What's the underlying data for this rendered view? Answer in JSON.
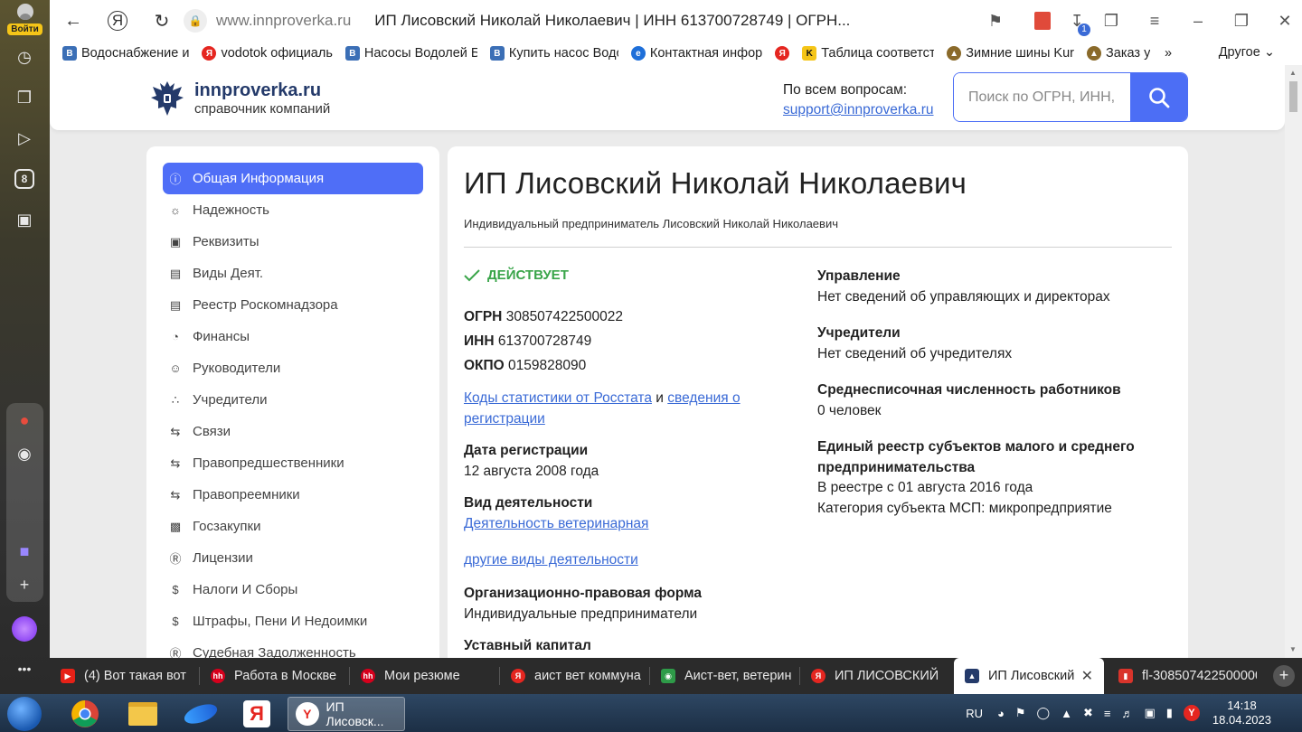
{
  "rail": {
    "login_label": "Войти",
    "tab_badge": "8"
  },
  "browser": {
    "host": "www.innproverka.ru",
    "page_title": "ИП Лисовский Николай Николаевич | ИНН 613700728749 | ОГРН...",
    "downloads_badge": "1"
  },
  "bookmarks": {
    "items": [
      {
        "label": "Водоснабжение и",
        "icon": "vk-icon",
        "color": "#3b6fb6"
      },
      {
        "label": "vodotok официаль",
        "icon": "yandex-icon",
        "color": "#e52620"
      },
      {
        "label": "Насосы Водолей Б",
        "icon": "vk-icon",
        "color": "#3b6fb6"
      },
      {
        "label": "Купить насос Водо",
        "icon": "vk-icon",
        "color": "#3b6fb6"
      },
      {
        "label": "Контактная инфор",
        "icon": "edge-icon",
        "color": "#1e6fd9"
      },
      {
        "label": "",
        "icon": "yandex-icon",
        "color": "#e52620"
      },
      {
        "label": "Таблица соответст",
        "icon": "k-icon",
        "color": "#111111"
      },
      {
        "label": "Зимние шины Kur",
        "icon": "bird-icon",
        "color": "#8a6a2a"
      },
      {
        "label": "Заказ у",
        "icon": "bird-icon",
        "color": "#8a6a2a"
      }
    ],
    "other_label": "Другое"
  },
  "site": {
    "logo_name": "innproverka.ru",
    "logo_sub": "справочник компаний",
    "contact_label": "По всем вопросам:",
    "contact_email": "support@innproverka.ru",
    "search_placeholder": "Поиск по ОГРН, ИНН, н"
  },
  "sidebar": {
    "items": [
      {
        "label": "Общая Информация",
        "icon": "info-icon",
        "active": true
      },
      {
        "label": "Надежность",
        "icon": "bulb-icon"
      },
      {
        "label": "Реквизиты",
        "icon": "qr-icon"
      },
      {
        "label": "Виды Деят.",
        "icon": "briefcase-icon"
      },
      {
        "label": "Реестр Роскомнадзора",
        "icon": "briefcase-icon"
      },
      {
        "label": "Финансы",
        "icon": "pie-icon"
      },
      {
        "label": "Руководители",
        "icon": "person-icon"
      },
      {
        "label": "Учредители",
        "icon": "group-icon"
      },
      {
        "label": "Связи",
        "icon": "swap-icon"
      },
      {
        "label": "Правопредшественники",
        "icon": "swap-icon"
      },
      {
        "label": "Правопреемники",
        "icon": "swap-icon"
      },
      {
        "label": "Госзакупки",
        "icon": "money-icon"
      },
      {
        "label": "Лицензии",
        "icon": "tm-icon"
      },
      {
        "label": "Налоги И Сборы",
        "icon": "dollar-icon"
      },
      {
        "label": "Штрафы, Пени И Недоимки",
        "icon": "dollar-icon"
      },
      {
        "label": "Судебная Задолженность",
        "icon": "tm-icon"
      }
    ]
  },
  "company": {
    "title": "ИП Лисовский Николай Николаевич",
    "full_name": "Индивидуальный предприниматель Лисовский Николай Николаевич",
    "status": "ДЕЙСТВУЕТ",
    "ogrn_label": "ОГРН",
    "ogrn": "308507422500022",
    "inn_label": "ИНН",
    "inn": "613700728749",
    "okpo_label": "ОКПО",
    "okpo": "0159828090",
    "codes_link": "Коды статистики от Росстата",
    "and": "и",
    "reg_link_1": "сведения о",
    "reg_link_2": "регистрации",
    "reg_date_label": "Дата регистрации",
    "reg_date": "12 августа 2008 года",
    "activity_label": "Вид деятельности",
    "activity": "Деятельность ветеринарная",
    "other_activity": "другие виды деятельности",
    "opf_label": "Организационно-правовая форма",
    "opf": "Индивидуальные предприниматели",
    "capital_label": "Уставный капитал",
    "mgmt_label": "Управление",
    "mgmt": "Нет сведений об управляющих и директорах",
    "founders_label": "Учредители",
    "founders": "Нет сведений об учредителях",
    "staff_label": "Среднесписочная численность работников",
    "staff": "0 человек",
    "msp_label_1": "Единый реестр субъектов малого и среднего",
    "msp_label_2": "предпринимательства",
    "msp_since": "В реестре с 01 августа 2016 года",
    "msp_category": "Категория субъекта МСП: микропредприятие"
  },
  "tabs": [
    {
      "label": "(4) Вот такая вот",
      "icon": "youtube-icon",
      "color": "#e62117"
    },
    {
      "label": "Работа в Москве",
      "icon": "hh-icon",
      "color": "#d6001c"
    },
    {
      "label": "Мои резюме",
      "icon": "hh-icon",
      "color": "#d6001c"
    },
    {
      "label": "аист вет коммуна",
      "icon": "yandex-icon",
      "color": "#e52620"
    },
    {
      "label": "Аист-вет, ветерин",
      "icon": "map-icon",
      "color": "#2e9b48"
    },
    {
      "label": "ИП ЛИСОВСКИЙ",
      "icon": "yandex-icon",
      "color": "#e52620"
    },
    {
      "label": "ИП Лисовский",
      "icon": "eagle-icon",
      "color": "#243a6a",
      "active": true
    },
    {
      "label": "fl-308507422500000",
      "icon": "pdf-icon",
      "color": "#d9342b"
    }
  ],
  "taskbar": {
    "active_window": "ИП Лисовск...",
    "lang": "RU",
    "time": "14:18",
    "date": "18.04.2023"
  }
}
